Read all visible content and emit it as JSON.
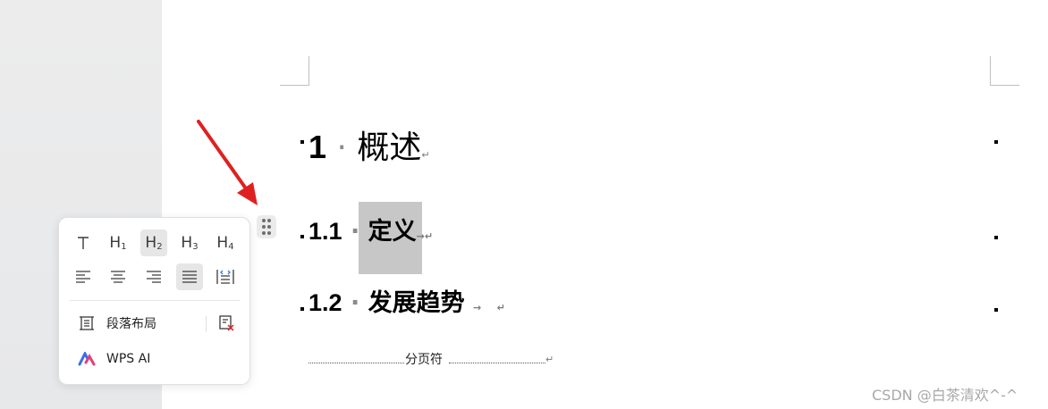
{
  "document": {
    "heading1": {
      "number": "1",
      "text": "概述"
    },
    "heading2_a": {
      "number": "1.1",
      "text": "定义"
    },
    "heading2_b": {
      "number": "1.2",
      "text": "发展趋势"
    },
    "page_break_label": "分页符",
    "para_mark": "↵",
    "tab_mark": "→"
  },
  "popup": {
    "heading_buttons": [
      {
        "label": "T",
        "name": "body-text"
      },
      {
        "label": "H1",
        "name": "heading-1"
      },
      {
        "label": "H2",
        "name": "heading-2",
        "active": true
      },
      {
        "label": "H3",
        "name": "heading-3"
      },
      {
        "label": "H4",
        "name": "heading-4"
      }
    ],
    "align_buttons": [
      "align-left-icon",
      "align-center-icon",
      "align-right-icon",
      "align-justify-icon",
      "distribute-icon"
    ],
    "paragraph_layout_label": "段落布局",
    "wps_ai_label": "WPS AI"
  },
  "watermark": "CSDN @白茶清欢^-^",
  "colors": {
    "arrow": "#e02020",
    "selection": "#c7c7c7",
    "popup_active": "#e6e6e6"
  }
}
